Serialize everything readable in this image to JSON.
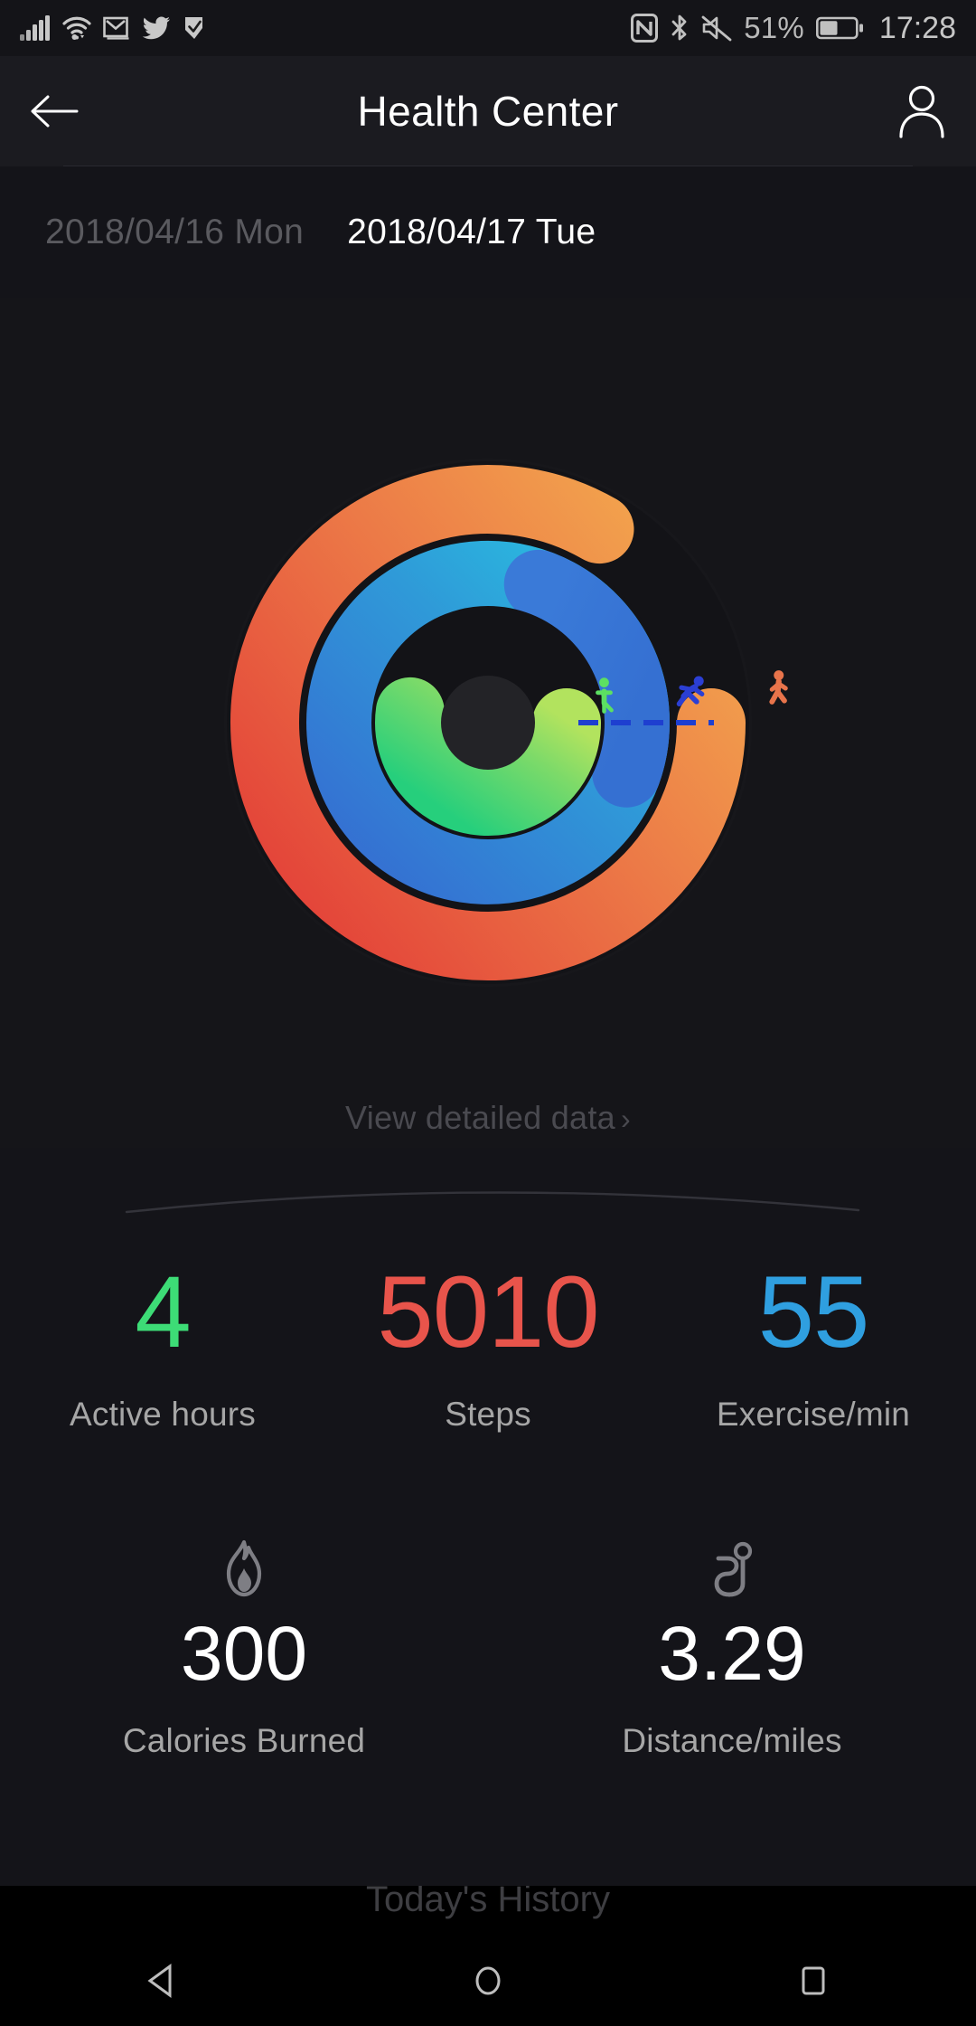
{
  "status_bar": {
    "left_icons": [
      "signal-bars-icon",
      "wifi-icon",
      "gmail-icon",
      "twitter-icon",
      "checkmark-app-icon"
    ],
    "right_icons": [
      "nfc-icon",
      "bluetooth-icon",
      "mute-icon"
    ],
    "battery_percent": "51%",
    "battery_level": 51,
    "clock": "17:28"
  },
  "header": {
    "title": "Health Center",
    "back_icon": "back-arrow-icon",
    "profile_icon": "person-icon"
  },
  "date_tabs": [
    {
      "label": "2018/04/16 Mon",
      "active": false
    },
    {
      "label": "2018/04/17 Tue",
      "active": true
    }
  ],
  "detail_link": {
    "label": "View detailed data",
    "chevron": "›"
  },
  "colors": {
    "active_hours_green": "#3ddc76",
    "active_hours_green_light": "#a6e061",
    "steps_red": "#e8483f",
    "steps_orange": "#f0a04b",
    "exercise_blue": "#3479d6",
    "exercise_cyan": "#2bbbdd",
    "background": "#141419",
    "panel": "#151519",
    "label_grey": "#a6a6a6",
    "inactive_grey": "#5a5a5f"
  },
  "chart_data": {
    "type": "pie",
    "title": "Daily Activity Rings",
    "subtitle": "Concentric progress arcs, start angle 3 o'clock (0°), clockwise",
    "legend_position": "inline-icons-at-start-angle",
    "rings": [
      {
        "name": "Steps",
        "ring": "outer",
        "icon": "walking-person-icon",
        "icon_color": "#e8744b",
        "value": 5010,
        "unit": "steps",
        "sweep_degrees": 300,
        "progress_fraction": 0.83,
        "gradient_from": "#f0a04b",
        "gradient_to": "#e8483f",
        "cap": "round"
      },
      {
        "name": "Exercise",
        "ring": "middle",
        "icon": "running-person-icon",
        "icon_color": "#2b3fd4",
        "value": 55,
        "unit": "min",
        "sweep_degrees": 390,
        "progress_fraction": 1.08,
        "gradient_from": "#2bbbdd",
        "gradient_to": "#3479d6",
        "cap": "round",
        "overflow": true
      },
      {
        "name": "Active hours",
        "ring": "inner",
        "icon": "standing-person-icon",
        "icon_color": "#5ce062",
        "value": 4,
        "unit": "hours",
        "sweep_degrees": 188,
        "progress_fraction": 0.52,
        "gradient_from": "#a6e061",
        "gradient_to": "#2fd07a",
        "cap": "round"
      }
    ],
    "goal_marker": {
      "style": "dashed",
      "color": "#1e3fd0",
      "at_degrees": 0
    }
  },
  "stats_primary": [
    {
      "value": "4",
      "label": "Active hours",
      "color": "#3ddc76"
    },
    {
      "value": "5010",
      "label": "Steps",
      "color": "#e8544b"
    },
    {
      "value": "55",
      "label": "Exercise/min",
      "color": "#2f9fe0"
    }
  ],
  "stats_secondary": [
    {
      "icon": "flame-icon",
      "value": "300",
      "label": "Calories Burned"
    },
    {
      "icon": "route-pin-icon",
      "value": "3.29",
      "label": "Distance/miles"
    }
  ],
  "history_section": {
    "title": "Today's History"
  },
  "nav_bar": {
    "back": "nav-back-triangle-icon",
    "home": "nav-home-circle-icon",
    "recents": "nav-recents-square-icon"
  }
}
